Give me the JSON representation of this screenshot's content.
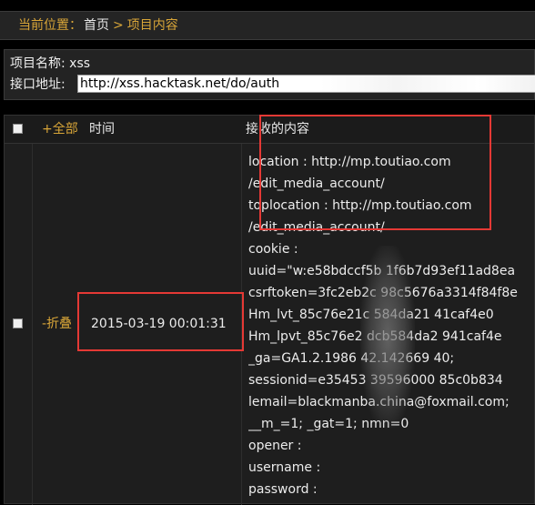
{
  "breadcrumb": {
    "label": "当前位置：",
    "home": "首页",
    "separator": ">",
    "current": "项目内容"
  },
  "project": {
    "name_label": "项目名称:",
    "name_value": "xss",
    "api_label": "接口地址:",
    "api_value": "http://xss.hacktask.net/do/auth"
  },
  "table": {
    "header": {
      "all": "+全部",
      "time": "时间",
      "content": "接收的内容"
    },
    "rows": [
      {
        "fold": "-折叠",
        "time": "2015-03-19 00:01:31",
        "content_lines": [
          "location : http://mp.toutiao.com",
          "/edit_media_account/",
          "toplocation : http://mp.toutiao.com",
          "/edit_media_account/",
          "cookie :",
          "uuid=\"w:e58bdccf5b    1f6b7d93ef11ad8ea",
          "csrftoken=3fc2eb2c    98c5676a3314f84f8e",
          "Hm_lvt_85c76e21c      584da21    41caf4e0",
          "Hm_lpvt_85c76e2     dcb584da2    941caf4e",
          "_ga=GA1.2.1986      42.142669    40;",
          "sessionid=e35453    39596000     85c0b834",
          "lemail=blackmanba.china@foxmail.com;",
          "__m_=1; _gat=1; nmn=0",
          "opener :",
          "username :",
          "password :"
        ]
      }
    ]
  }
}
